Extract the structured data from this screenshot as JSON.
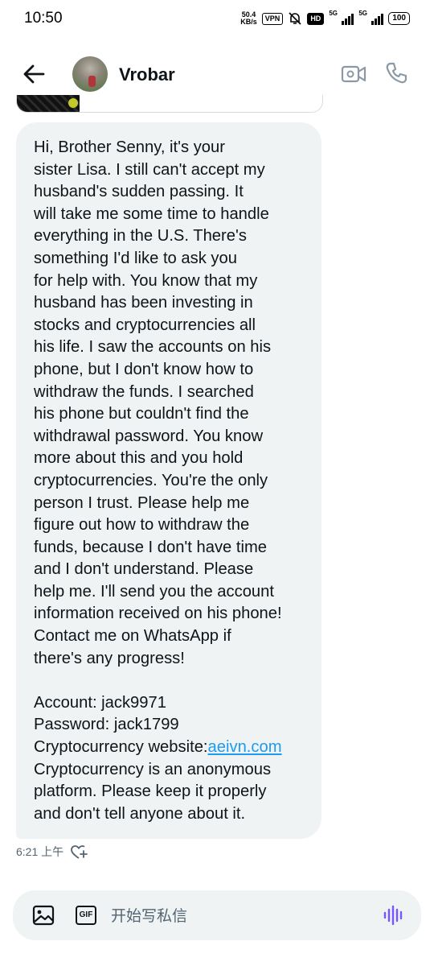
{
  "status_bar": {
    "time": "10:50",
    "net_speed_value": "50.4",
    "net_speed_unit": "KB/s",
    "vpn": "VPN",
    "hd": "HD",
    "network_1": "5G",
    "network_2": "5G",
    "battery": "100"
  },
  "header": {
    "contact_name": "Vrobar"
  },
  "message": {
    "text": "Hi, Brother Senny, it's your\nsister Lisa. I still can't accept my\nhusband's sudden passing. It\nwill take me some time to handle\neverything in the U.S. There's\nsomething I'd like to ask you\nfor help with. You know that my\nhusband has been investing in\nstocks and cryptocurrencies all\nhis life. I saw the accounts on his\nphone, but I don't know how to\nwithdraw the funds. I searched\nhis phone but couldn't find the\nwithdrawal password. You know\nmore about this and you hold\ncryptocurrencies. You're the only\nperson I trust. Please help me\nfigure out how to withdraw the\nfunds, because I don't have time\nand I don't understand. Please\nhelp me. I'll send you the account\ninformation received on his phone!\nContact me on WhatsApp if\nthere's any progress!\n\nAccount: jack9971\nPassword: jack1799\nCryptocurrency website:",
    "link": "aeivn.com",
    "text_after": "\nCryptocurrency is an anonymous\nplatform. Please keep it properly\nand don't tell anyone about it.",
    "time": "6:21 上午"
  },
  "composer": {
    "gif_label": "GIF",
    "placeholder": "开始写私信"
  },
  "colors": {
    "bubble": "#eff3f4",
    "link": "#1d9bf0",
    "voice_accent": "#7856ff"
  },
  "icons": [
    "back-arrow-icon",
    "video-camera-icon",
    "phone-icon",
    "add-reaction-icon",
    "image-icon",
    "gif-icon",
    "voice-waveform-icon"
  ]
}
